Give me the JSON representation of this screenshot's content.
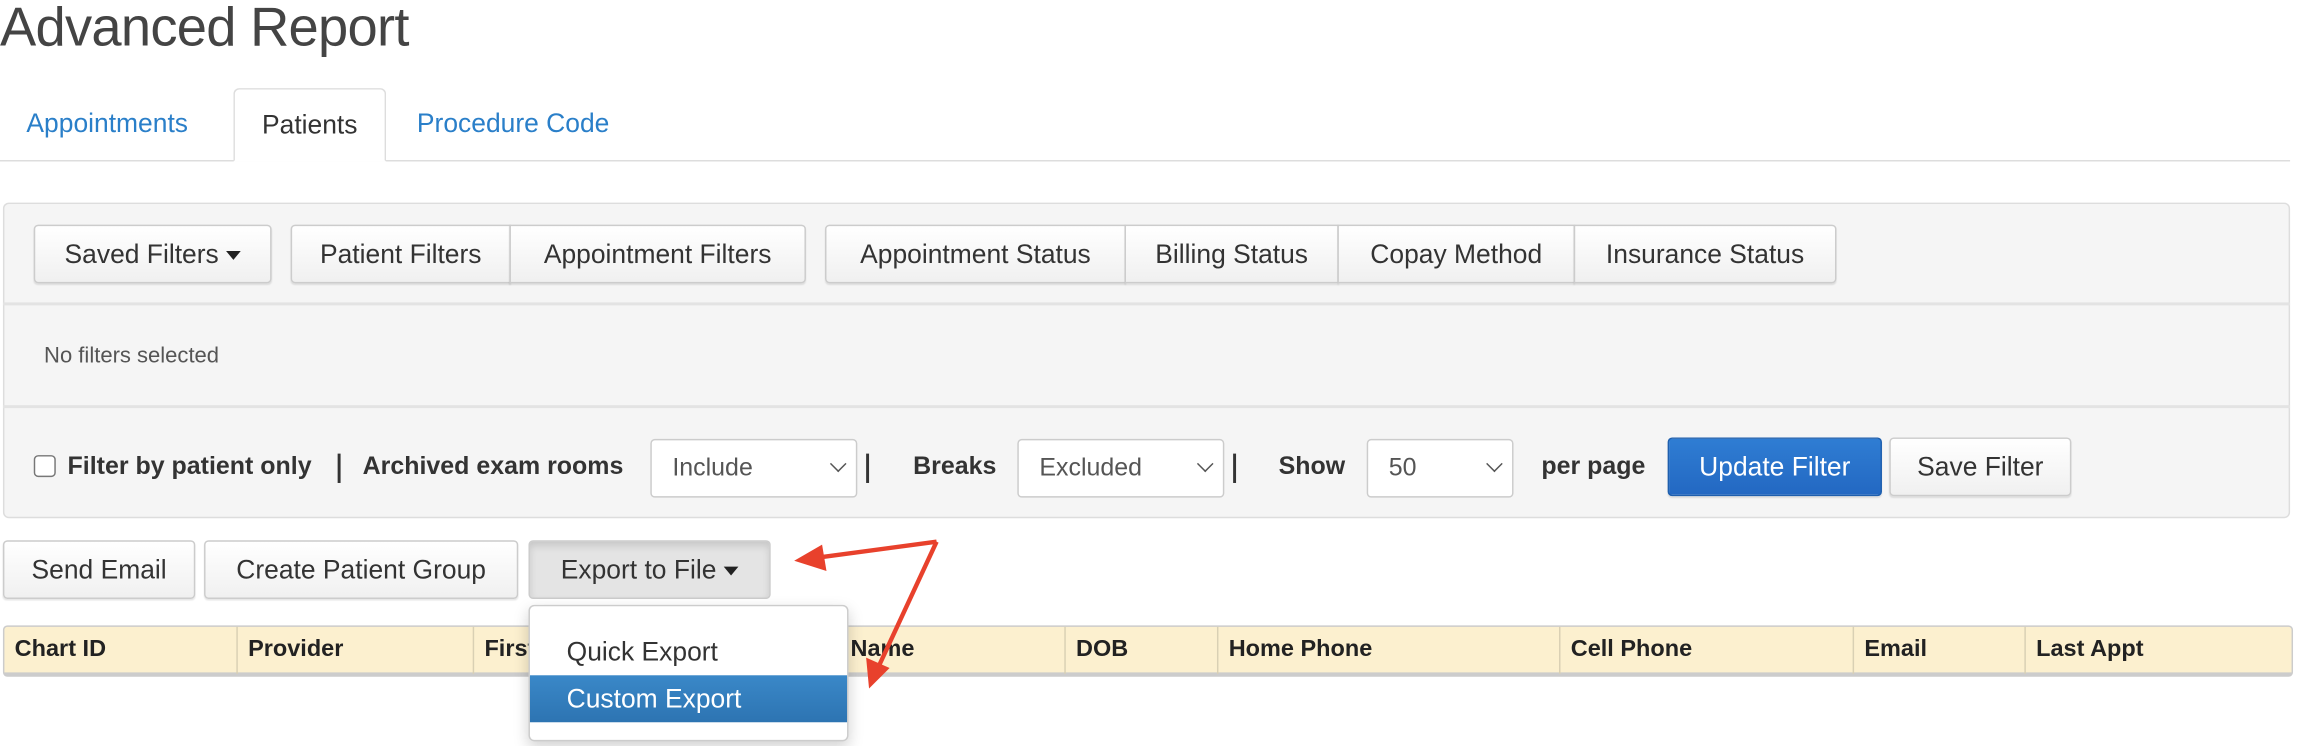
{
  "page": {
    "title": "Advanced Report"
  },
  "tabs": [
    {
      "label": "Appointments",
      "active": false
    },
    {
      "label": "Patients",
      "active": true
    },
    {
      "label": "Procedure Code",
      "active": false
    }
  ],
  "filters": {
    "saved_filters": "Saved Filters",
    "group1": [
      "Patient Filters",
      "Appointment Filters"
    ],
    "group2": [
      "Appointment Status",
      "Billing Status",
      "Copay Method",
      "Insurance Status"
    ],
    "status_text": "No filters selected",
    "filter_by_patient_only": {
      "label": "Filter by patient only",
      "checked": false
    },
    "archived_exam_rooms": {
      "label": "Archived exam rooms",
      "value": "Include"
    },
    "breaks": {
      "label": "Breaks",
      "value": "Excluded"
    },
    "show": {
      "label": "Show",
      "value": "50",
      "suffix": "per page"
    },
    "update_filter": "Update Filter",
    "save_filter": "Save Filter"
  },
  "actions": {
    "send_email": "Send Email",
    "create_patient_group": "Create Patient Group",
    "export_to_file": "Export to File"
  },
  "export_menu": {
    "items": [
      {
        "label": "Quick Export",
        "highlighted": false
      },
      {
        "label": "Custom Export",
        "highlighted": true
      }
    ]
  },
  "table": {
    "columns": [
      "Chart ID",
      "Provider",
      "First Name",
      "Last Name",
      "DOB",
      "Home Phone",
      "Cell Phone",
      "Email",
      "Last Appt"
    ]
  },
  "colors": {
    "link": "#2a7fc9",
    "primary": "#2670c9",
    "highlight": "#337ab7",
    "table_header": "#fcf0cf",
    "annotation_arrow": "#e8412c"
  }
}
